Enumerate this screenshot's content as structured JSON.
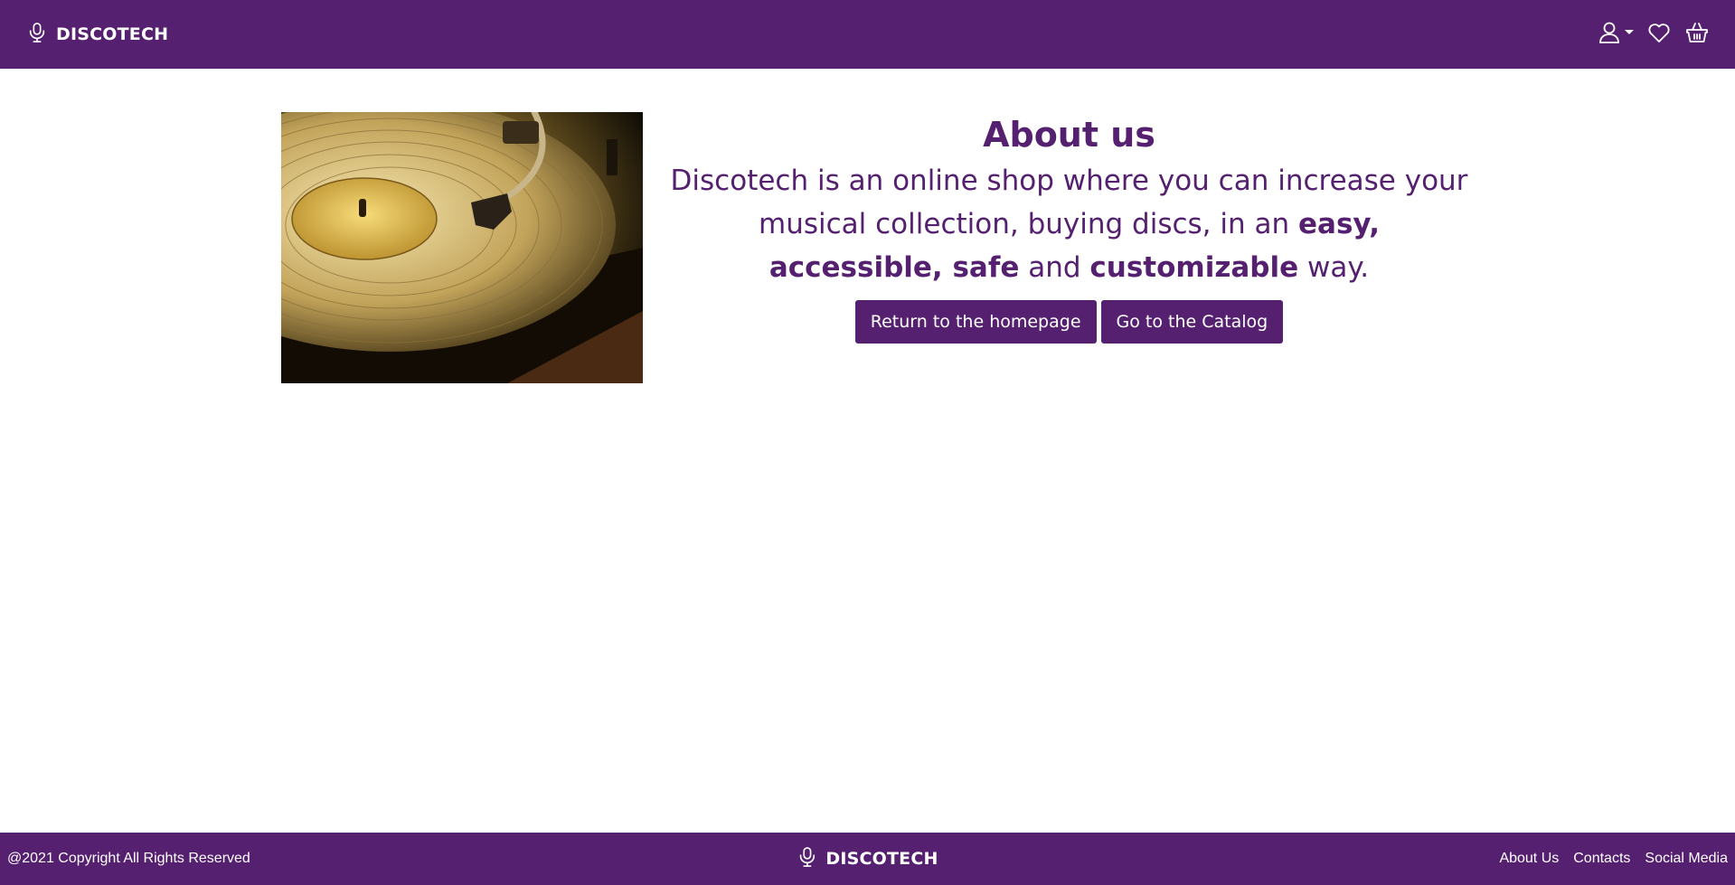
{
  "brand": {
    "name": "DISCOTECH",
    "icon": "microphone-icon"
  },
  "nav": {
    "icons": [
      "user-icon",
      "heart-icon",
      "basket-icon"
    ]
  },
  "about": {
    "title": "About us",
    "desc_part1": "Discotech is an online shop where you can increase your musical collection, buying discs, in an ",
    "desc_bold1": "easy, accessible, safe",
    "desc_part2": " and ",
    "desc_bold2": "customizable",
    "desc_part3": " way.",
    "image_alt": "turntable playing a vinyl record"
  },
  "buttons": {
    "home": "Return to the homepage",
    "catalog": "Go to the Catalog"
  },
  "footer": {
    "copyright": "@2021 Copyright All Rights Reserved",
    "brand": "DISCOTECH",
    "links": [
      "About Us",
      "Contacts",
      "Social Media"
    ]
  },
  "colors": {
    "primary": "#55206f",
    "background": "#ffffff"
  }
}
